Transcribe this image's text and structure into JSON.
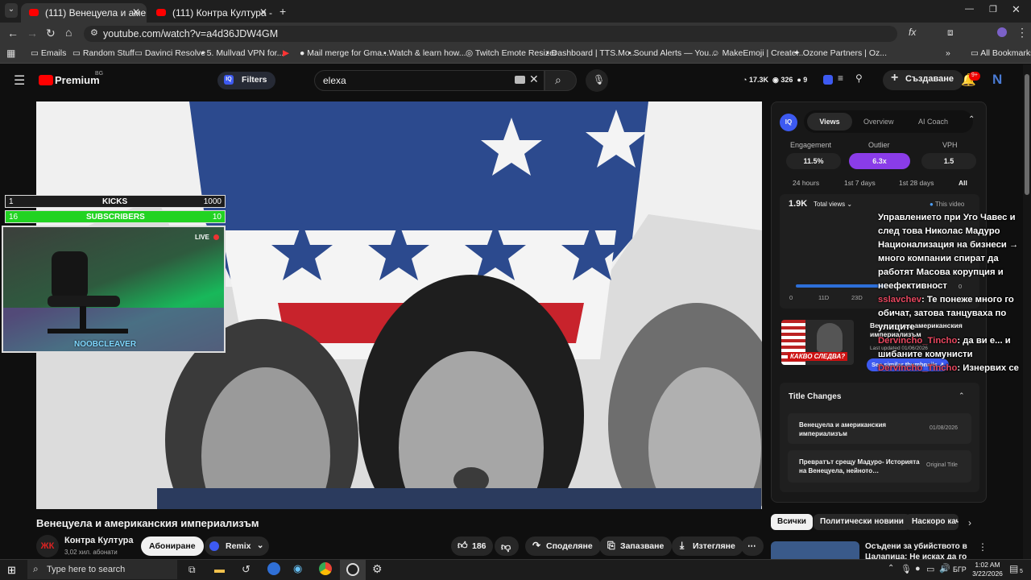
{
  "tabs": [
    {
      "title": "(111) Венецуела и америк…"
    },
    {
      "title": "(111) Контра Култура - YouTub…"
    }
  ],
  "browser": {
    "url": "youtube.com/watch?v=a4d36JDW4GM"
  },
  "bookmarks": [
    "Emails",
    "Random Stuff",
    "Davinci Resolve",
    "5. Mullvad VPN for...",
    "Mail merge for Gma...",
    "Watch & learn how...",
    "Twitch Emote Resizer",
    "Dashboard | TTS.Mo...",
    "Sound Alerts — You...",
    "MakeEmoji | Create...",
    "Ozone Partners | Oz...",
    "All Bookmarks"
  ],
  "yt": {
    "logo": "Premium",
    "region": "BG",
    "filters": "Filters",
    "search_value": "elexa",
    "stats": {
      "a": "17.3K",
      "b": "326",
      "c": "9"
    },
    "create": "Създаване",
    "notif": "9+",
    "avatar": "N"
  },
  "overlay": {
    "kicks_left": "1",
    "kicks_label": "KICKS",
    "kicks_right": "1000",
    "subs_left": "16",
    "subs_label": "SUBSCRIBERS",
    "subs_right": "10",
    "live": "LIVE",
    "streamer": "NOOBCLEAVER"
  },
  "panel": {
    "tabs": [
      "Views",
      "Overview",
      "AI Coach"
    ],
    "metrics": [
      {
        "label": "Engagement",
        "value": "11.5%"
      },
      {
        "label": "Outlier",
        "value": "6.3x"
      },
      {
        "label": "VPH",
        "value": "1.5"
      }
    ],
    "ranges": [
      "24 hours",
      "1st 7 days",
      "1st 28 days",
      "All"
    ],
    "total": "1.9K",
    "total_select": "Total views",
    "legend": "This video",
    "axis": [
      "0",
      "11D",
      "23D"
    ],
    "y0": "0",
    "similar_title": "Венецуела и американския империализъм",
    "last_updated": "Last updated 01/06/2026",
    "similar_btn": "See similar thumbnails",
    "thumb_text": "КАКВО СЛЕДВА?",
    "title_changes": "Title Changes",
    "changes": [
      {
        "title": "Венецуела и американския империализъм",
        "meta": "01/08/2026"
      },
      {
        "title": "Превратът срещу Мадуро- Историята на Венецуела, нейното…",
        "meta": "Original Title"
      }
    ]
  },
  "chat": {
    "line1": "Управлението при Уго Чавес и след това Николас Мадуро Национализация на бизнеси → много компании спират да работят Масова корупция и неефективност",
    "msgs": [
      {
        "user": "sslavchev",
        "text": ": Те понеже много го обичат, затова танцуваха по улиците"
      },
      {
        "user": "Dervincho_Tincho",
        "text": ": да ви е... и шибаните комунисти"
      },
      {
        "user": "Dervincho_Tincho",
        "text": ": Изнервих се"
      }
    ]
  },
  "video": {
    "title": "Венецуела и американския империализъм",
    "channel": "Контра Култура",
    "subs": "3,02 хил. абонати",
    "subscribe": "Абониране",
    "remix": "Remix",
    "likes": "186",
    "share": "Споделяне",
    "save": "Запазване",
    "download": "Изтегляне"
  },
  "chips": [
    "Всички",
    "Политически новини",
    "Наскоро кач"
  ],
  "rec": {
    "title": "Осъдени за убийството в Цалапица: Не исках да го"
  },
  "taskbar": {
    "search": "Type here to search",
    "time": "1:02 AM",
    "date": "3/22/2026",
    "lang": "БГР",
    "notif": "5"
  }
}
